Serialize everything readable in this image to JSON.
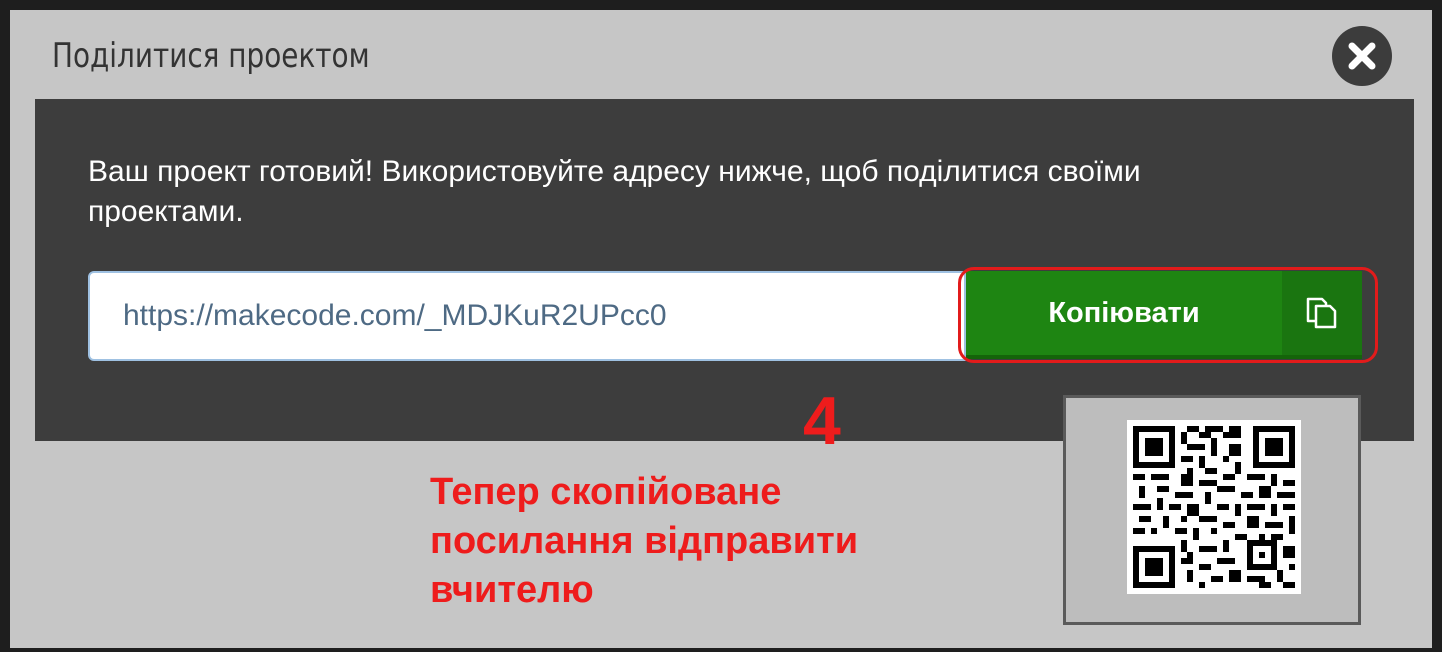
{
  "dialog": {
    "title": "Поділитися проектом",
    "close_icon": "close-icon"
  },
  "share": {
    "message": "Ваш проект готовий! Використовуйте адресу нижче, щоб поділитися своїми проектами.",
    "url": "https://makecode.com/_MDJKuR2UPcc0",
    "copy_label": "Копіювати",
    "copy_icon": "copy-icon",
    "qr_icon": "qr-code-icon"
  },
  "annotation": {
    "step": "4",
    "text": "Тепер скопійоване посилання відправити вчителю",
    "color": "#ee1c1c"
  },
  "colors": {
    "dialog_bg": "#c6c6c6",
    "panel_bg": "#3d3d3d",
    "copy_button": "#1e8512"
  }
}
